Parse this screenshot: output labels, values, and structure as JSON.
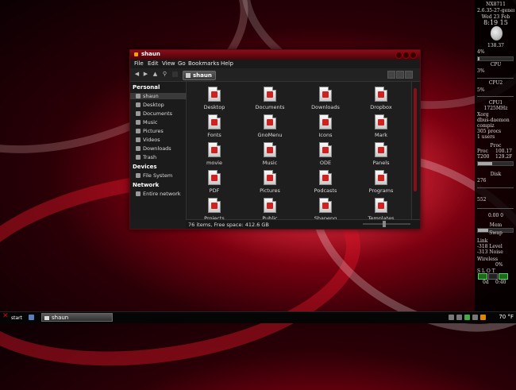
{
  "window": {
    "title": "shaun",
    "menu": [
      "File",
      "Edit",
      "View",
      "Go",
      "Bookmarks",
      "Help"
    ],
    "breadcrumb": "shaun",
    "status": "76 items, Free space: 412.6 GB"
  },
  "sidebar": {
    "personal_header": "Personal",
    "personal": [
      "shaun",
      "Desktop",
      "Documents",
      "Music",
      "Pictures",
      "Videos",
      "Downloads",
      "Trash"
    ],
    "devices_header": "Devices",
    "devices": [
      "File System"
    ],
    "network_header": "Network",
    "network": [
      "Entire network"
    ]
  },
  "files": [
    "Desktop",
    "Documents",
    "Downloads",
    "Dropbox",
    "Fonts",
    "GnoMenu",
    "Icons",
    "Mark",
    "movie",
    "Music",
    "ODE",
    "Panels",
    "PDF",
    "Pictures",
    "Podcasts",
    "Programs",
    "Projects",
    "Public",
    "Shapeng",
    "Templates"
  ],
  "conky": {
    "host": "NX8711",
    "kernel": "2.6.35-27-generic",
    "date": "Wed 23 Feb",
    "time": "8:19 15",
    "moon": "138.37",
    "moon_pct": "4%",
    "cpu_label1": "CPU",
    "cpu1_pct": "3%",
    "cpu_label2": "CPU2",
    "cpu2_pct": "5%",
    "cpu_block": "CPU1",
    "freq": "1725MHz",
    "fs_a": "Xorg",
    "fs_b": "dbus-daemon",
    "fs_c": "compiz",
    "procs": "305 procs",
    "users": "1 users",
    "proc_label": "Proc",
    "p1_name": "Proc",
    "p1_val": "100.17",
    "p2_name": "T200",
    "p2_val": "129.2F",
    "disk_label": "Disk",
    "disk1": "276",
    "disk2": "552",
    "net_in": "0.00 0",
    "mem_label": "Mem",
    "swap_label": "Swap",
    "link": "Link",
    "level": "-318 Level",
    "noise": "-313 Noise",
    "wireless": "Wireless",
    "wl_val": "0%",
    "ssid": "S L O T",
    "od": "0d",
    "od_val": "0:40"
  },
  "taskbar": {
    "start": "start",
    "task": "shaun",
    "temp": "70 °F"
  }
}
